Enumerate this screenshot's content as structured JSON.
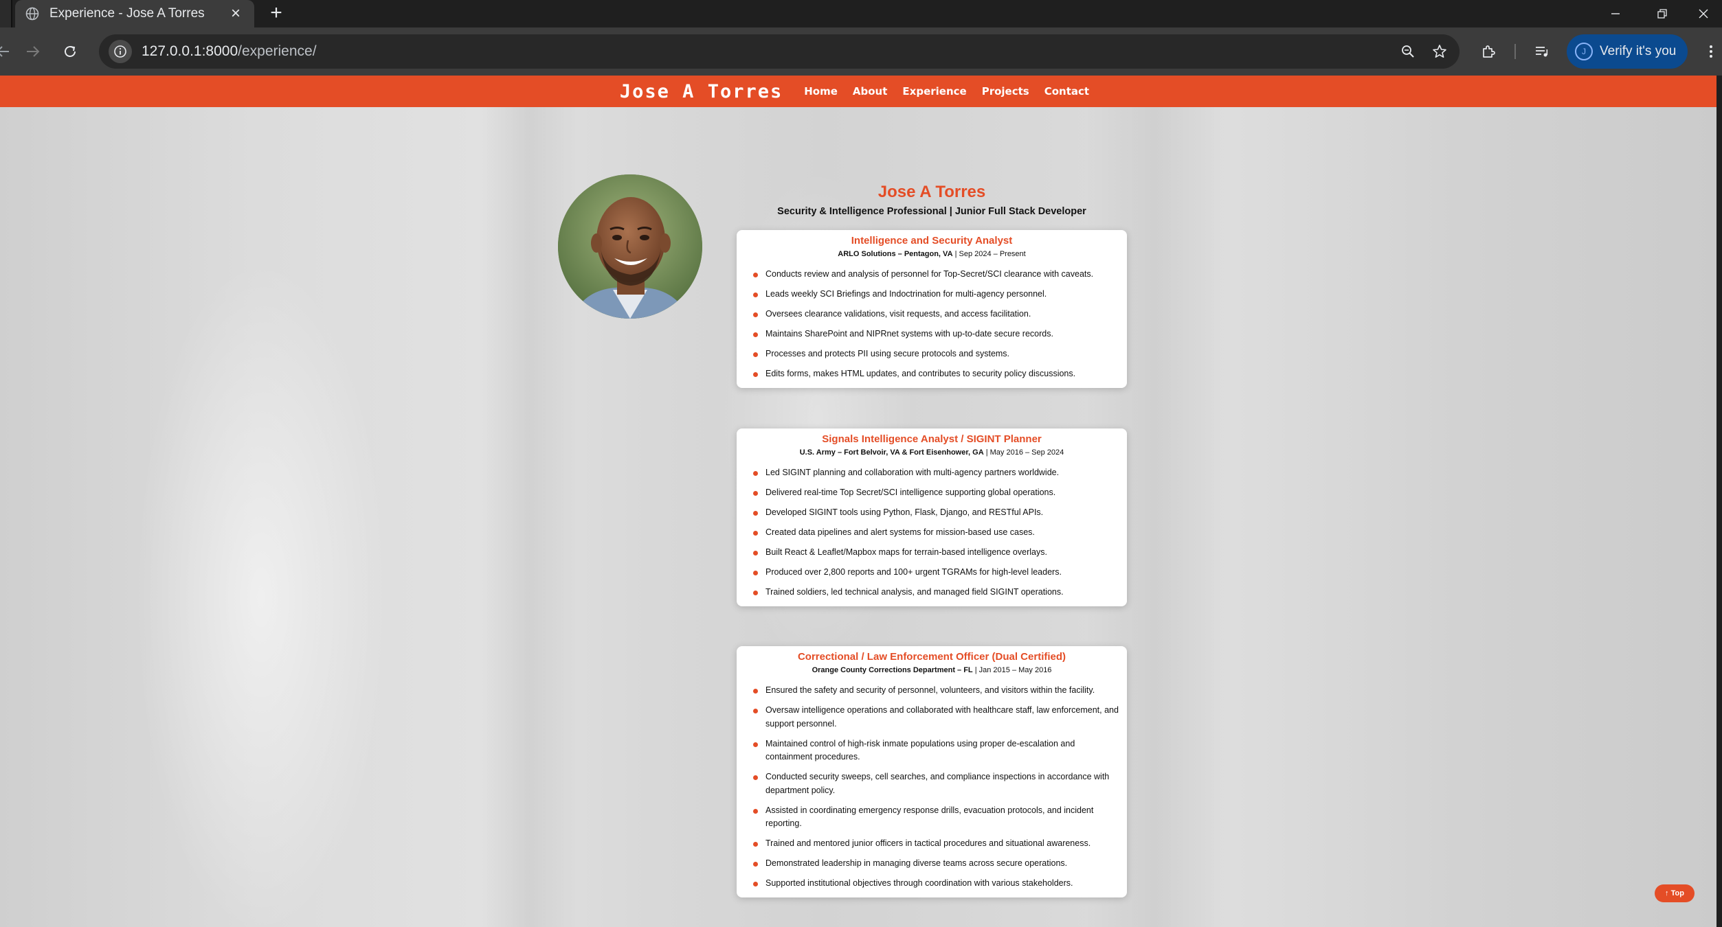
{
  "browser": {
    "tab_title": "Experience - Jose A Torres",
    "url_host": "127.0.0.1:8000",
    "url_path": "/experience/",
    "profile_label": "Verify it's you",
    "profile_initial": "J"
  },
  "site": {
    "brand": "Jose A Torres",
    "nav": [
      "Home",
      "About",
      "Experience",
      "Projects",
      "Contact"
    ]
  },
  "profile": {
    "name": "Jose A Torres",
    "tagline": "Security & Intelligence Professional | Junior Full Stack Developer"
  },
  "experience": [
    {
      "title": "Intelligence and Security Analyst",
      "org": "ARLO Solutions – Pentagon, VA",
      "dates": " | Sep 2024 – Present",
      "bullets": [
        "Conducts review and analysis of personnel for Top-Secret/SCI clearance with caveats.",
        "Leads weekly SCI Briefings and Indoctrination for multi-agency personnel.",
        "Oversees clearance validations, visit requests, and access facilitation.",
        "Maintains SharePoint and NIPRnet systems with up-to-date secure records.",
        "Processes and protects PII using secure protocols and systems.",
        "Edits forms, makes HTML updates, and contributes to security policy discussions."
      ]
    },
    {
      "title": "Signals Intelligence Analyst / SIGINT Planner",
      "org": "U.S. Army – Fort Belvoir, VA & Fort Eisenhower, GA",
      "dates": " | May 2016 – Sep 2024",
      "bullets": [
        "Led SIGINT planning and collaboration with multi-agency partners worldwide.",
        "Delivered real-time Top Secret/SCI intelligence supporting global operations.",
        "Developed SIGINT tools using Python, Flask, Django, and RESTful APIs.",
        "Created data pipelines and alert systems for mission-based use cases.",
        "Built React & Leaflet/Mapbox maps for terrain-based intelligence overlays.",
        "Produced over 2,800 reports and 100+ urgent TGRAMs for high-level leaders.",
        "Trained soldiers, led technical analysis, and managed field SIGINT operations."
      ]
    },
    {
      "title": "Correctional / Law Enforcement Officer (Dual Certified)",
      "org": "Orange County Corrections Department – FL",
      "dates": " | Jan 2015 – May 2016",
      "bullets": [
        "Ensured the safety and security of personnel, volunteers, and visitors within the facility.",
        "Oversaw intelligence operations and collaborated with healthcare staff, law enforcement, and support personnel.",
        "Maintained control of high-risk inmate populations using proper de-escalation and containment procedures.",
        "Conducted security sweeps, cell searches, and compliance inspections in accordance with department policy.",
        "Assisted in coordinating emergency response drills, evacuation protocols, and incident reporting.",
        "Trained and mentored junior officers in tactical procedures and situational awareness.",
        "Demonstrated leadership in managing diverse teams across secure operations.",
        "Supported institutional objectives through coordination with various stakeholders."
      ]
    }
  ],
  "back_to_top": "↑ Top"
}
